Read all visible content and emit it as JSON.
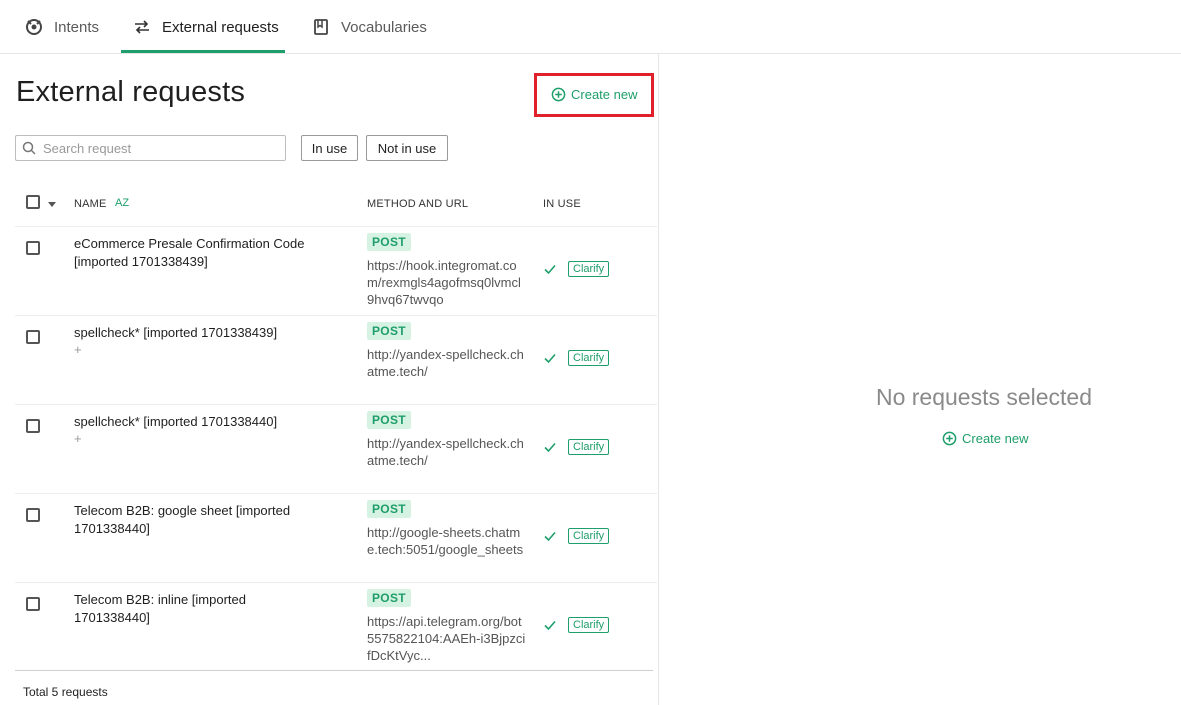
{
  "tabs": [
    {
      "label": "Intents",
      "icon": "intents-icon",
      "active": false
    },
    {
      "label": "External requests",
      "icon": "api-icon",
      "active": true
    },
    {
      "label": "Vocabularies",
      "icon": "book-icon",
      "active": false
    }
  ],
  "left": {
    "title": "External requests",
    "create_label": "Create new",
    "search_placeholder": "Search request",
    "filters": [
      "In use",
      "Not in use"
    ],
    "columns": {
      "name": "NAME",
      "method_url": "METHOD AND URL",
      "in_use": "IN USE"
    },
    "sort_icon_text": "AZ",
    "rows": [
      {
        "name": "eCommerce Presale Confirmation Code [imported 1701338439]",
        "sub": "",
        "method": "POST",
        "url": "https://hook.integromat.com/rexmgls4agofmsq0lvmcl9hvq67twvqo",
        "clarify": "Clarify"
      },
      {
        "name": "spellcheck* [imported 1701338439]",
        "sub": "+",
        "method": "POST",
        "url": "http://yandex-spellcheck.chatme.tech/",
        "clarify": "Clarify"
      },
      {
        "name": "spellcheck* [imported 1701338440]",
        "sub": "+",
        "method": "POST",
        "url": "http://yandex-spellcheck.chatme.tech/",
        "clarify": "Clarify"
      },
      {
        "name": "Telecom B2B: google sheet [imported 1701338440]",
        "sub": "",
        "method": "POST",
        "url": "http://google-sheets.chatme.tech:5051/google_sheets",
        "clarify": "Clarify"
      },
      {
        "name": "Telecom B2B: inline [imported 1701338440]",
        "sub": "",
        "method": "POST",
        "url": "https://api.telegram.org/bot5575822104:AAEh-i3BjpzcifDcKtVyc...",
        "clarify": "Clarify"
      }
    ],
    "total": "Total 5 requests"
  },
  "right": {
    "empty_title": "No requests selected",
    "create_label": "Create new"
  },
  "colors": {
    "accent": "#1e9e6a",
    "highlight": "#e0202a",
    "method_bg": "#d6f2e3"
  }
}
